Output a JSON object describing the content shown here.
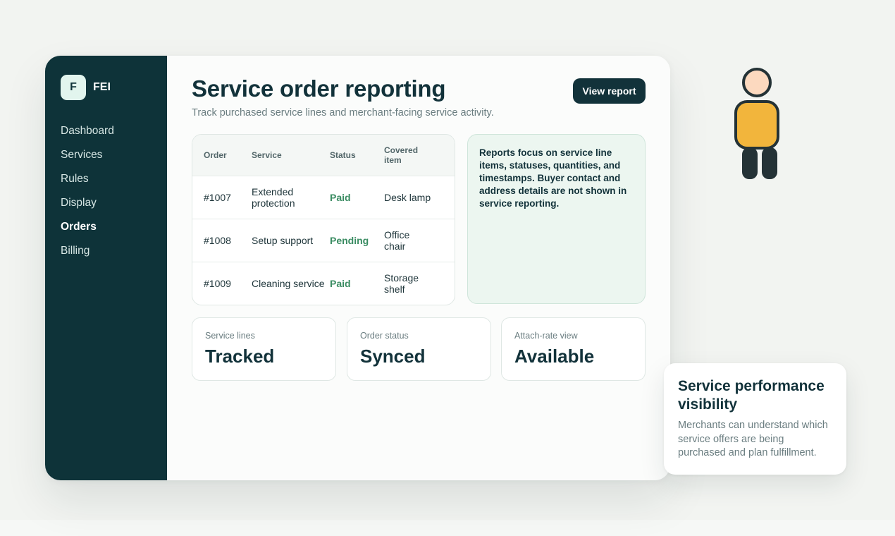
{
  "brand": {
    "mark": "F",
    "name": "FEI"
  },
  "sidebar": {
    "items": [
      {
        "label": "Dashboard",
        "active": false
      },
      {
        "label": "Services",
        "active": false
      },
      {
        "label": "Rules",
        "active": false
      },
      {
        "label": "Display",
        "active": false
      },
      {
        "label": "Orders",
        "active": true
      },
      {
        "label": "Billing",
        "active": false
      }
    ]
  },
  "header": {
    "title": "Service order reporting",
    "subtitle": "Track purchased service lines and merchant-facing service activity.",
    "button_label": "View report"
  },
  "table": {
    "columns": [
      "Order",
      "Service",
      "Status",
      "Covered item"
    ],
    "rows": [
      {
        "order": "#1007",
        "service": "Extended protection",
        "status": "Paid",
        "item": "Desk lamp"
      },
      {
        "order": "#1008",
        "service": "Setup support",
        "status": "Pending",
        "item": "Office chair"
      },
      {
        "order": "#1009",
        "service": "Cleaning service",
        "status": "Paid",
        "item": "Storage shelf"
      }
    ]
  },
  "note": {
    "text": "Reports focus on service line items, statuses, quantities, and timestamps. Buyer contact and address details are not shown in service reporting."
  },
  "stats": [
    {
      "label": "Service lines",
      "value": "Tracked"
    },
    {
      "label": "Order status",
      "value": "Synced"
    },
    {
      "label": "Attach-rate view",
      "value": "Available"
    }
  ],
  "callout": {
    "title": "Service performance visibility",
    "text": "Merchants can understand which service offers are being purchased and plan fulfillment."
  },
  "colors": {
    "sidebar": "#0e3339",
    "accent_dark": "#12323a",
    "status_green": "#3a8c62",
    "note_bg": "#ecf6f0",
    "person_body": "#f2b53c",
    "person_head": "#fcd9bf"
  },
  "icons": {
    "illustration": "person-illustration"
  }
}
